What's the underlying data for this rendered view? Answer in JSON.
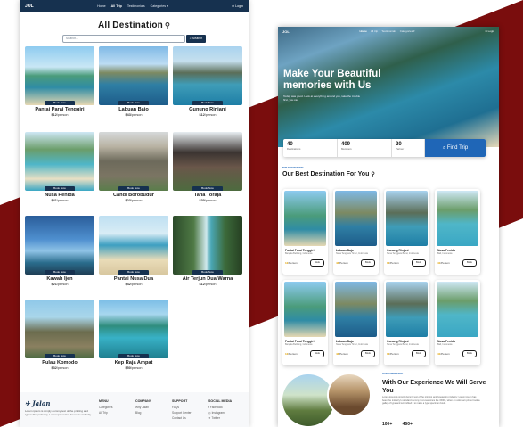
{
  "colors": {
    "maroon": "#7a0d0d",
    "navy": "#16314f",
    "accent_blue": "#1f66b7"
  },
  "left": {
    "nav": {
      "logo": "JOL",
      "links": [
        "Home",
        "All Trip",
        "Testimonials",
        "Categories ▾"
      ],
      "login": "⊕ Login"
    },
    "title": "All Destination",
    "search_placeholder": "Search...",
    "search_button": "⌕ Search",
    "book_label": "Book Now",
    "per_person": "/person",
    "destinations": [
      {
        "name": "Pantai Parai Tenggiri",
        "price": "$12"
      },
      {
        "name": "Labuan Bajo",
        "price": "$43"
      },
      {
        "name": "Gunung Rinjani",
        "price": "$12"
      },
      {
        "name": "Nusa Penida",
        "price": "$41"
      },
      {
        "name": "Candi Borobudur",
        "price": "$23"
      },
      {
        "name": "Tana Toraja",
        "price": "$30"
      },
      {
        "name": "Kawah Ijen",
        "price": "$21"
      },
      {
        "name": "Pantai Nusa Dua",
        "price": "$42"
      },
      {
        "name": "Air Terjun Dua Warna",
        "price": "$12"
      },
      {
        "name": "Pulau Komodo",
        "price": "$32"
      },
      {
        "name": "Kep Raja Ampat",
        "price": "$50"
      }
    ],
    "footer": {
      "brand": "Jalan",
      "desc": "Lorem ipsum is simply dummy text of the printing and typesetting industry. Lorem ipsum has been the industry...",
      "cols": [
        {
          "head": "MENU",
          "items": [
            "Categories",
            "All Trip"
          ]
        },
        {
          "head": "COMPANY",
          "items": [
            "Why Jalan",
            "Blog"
          ]
        },
        {
          "head": "SUPPORT",
          "items": [
            "FAQs",
            "Support Center",
            "Contact Us"
          ]
        },
        {
          "head": "SOCIAL MEDIA",
          "items": [
            "f Facebook",
            "◎ Instagram",
            "✦ Twitter"
          ]
        }
      ]
    }
  },
  "right": {
    "nav": {
      "logo": "JOL",
      "links": [
        "Home",
        "All trip",
        "Testimonials",
        "Categories ▾"
      ],
      "login": "⊕ Login"
    },
    "hero_title": "Make Your Beautiful memories with Us",
    "hero_sub": "Today was good. Look at everything around you, take the trouble first, you can",
    "stats": [
      {
        "n": "40",
        "l": "Destinations"
      },
      {
        "n": "409",
        "l": "Members"
      },
      {
        "n": "20",
        "l": "Partner"
      }
    ],
    "find_button": "⌕ Find Trip",
    "section_tag": "TOP DESTINATION",
    "section_title": "Our Best Destination For You",
    "book_label": "Book",
    "per_person": "/Person",
    "cards": [
      {
        "name": "Pantai Parai Tenggiri",
        "loc": "Bangka Belitung, Indonesia",
        "price": "12"
      },
      {
        "name": "Labuan Bajo",
        "loc": "Nusa Tenggara Timur, Indonesia",
        "price": "43"
      },
      {
        "name": "Gunung Rinjani",
        "loc": "Nusa Tenggara Barat, Indonesia",
        "price": "12"
      },
      {
        "name": "Nusa Penida",
        "loc": "Bali, Indonesia",
        "price": "41"
      },
      {
        "name": "Pantai Parai Tenggiri",
        "loc": "Bangka Belitung, Indonesia",
        "price": "12"
      },
      {
        "name": "Labuan Bajo",
        "loc": "Nusa Tenggara Timur, Indonesia",
        "price": "43"
      },
      {
        "name": "Gunung Rinjani",
        "loc": "Nusa Tenggara Barat, Indonesia",
        "price": "12"
      },
      {
        "name": "Nusa Penida",
        "loc": "Bali, Indonesia",
        "price": "41"
      }
    ],
    "exp_tag": "OUR EXPERIENCE",
    "exp_title": "With Our Experience We Will Serve You",
    "exp_desc": "Lorem ipsum is simply dummy text of the printing and typesetting industry. Lorem ipsum has been the industry's standard dummy text ever since the 1500s, when an unknown printer took a galley of type and scrambled it to make a type specimen book.",
    "exp_nums": [
      "100+",
      "460+"
    ]
  }
}
